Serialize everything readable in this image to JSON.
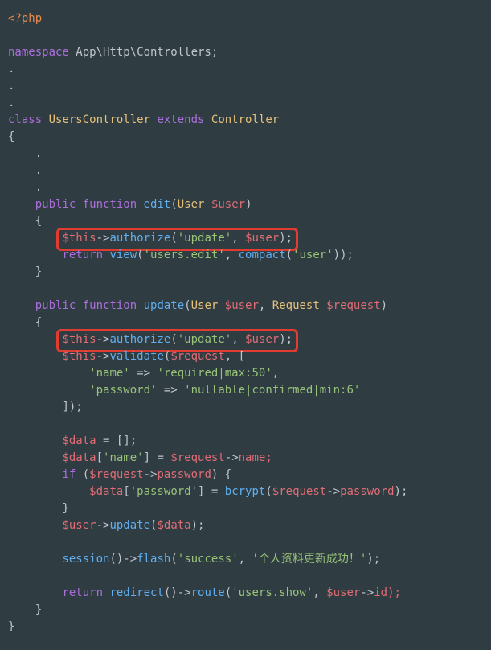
{
  "code": {
    "open_tag": "<?php",
    "ns_kw": "namespace",
    "ns": " App\\Http\\Controllers;",
    "dot1": ".",
    "dot2": ".",
    "dot3": ".",
    "class_kw": "class",
    "class_name": " UsersController ",
    "extends_kw": "extends",
    "base_class": " Controller",
    "ob": "{",
    "cb": "}",
    "dot4": ".",
    "dot5": ".",
    "dot6": ".",
    "public_kw": "public",
    "function_kw": " function",
    "edit_fn": " edit",
    "edit_params_open": "(",
    "user_type": "User ",
    "user_var": "$user",
    "edit_params_close": ")",
    "this_var": "$this",
    "arrow": "->",
    "authorize_fn": "authorize",
    "auth_open": "(",
    "update_str": "'update'",
    "comma": ", ",
    "auth_close": ");",
    "return_kw": "return",
    "view_fn": " view",
    "view_open": "(",
    "users_edit_str": "'users.edit'",
    "compact_fn": "compact",
    "compact_open": "(",
    "user_str": "'user'",
    "compact_close": "));",
    "update_fn": " update",
    "update_params_open": "(",
    "req_type": "Request ",
    "req_var": "$request",
    "update_params_close": ")",
    "validate_fn": "validate",
    "validate_open": "(",
    "arr_open": "[",
    "name_key_str": "'name'",
    "fat_arrow": " => ",
    "name_rule_str": "'required|max:50'",
    "comma2": ",",
    "pwd_key_str": "'password'",
    "pwd_rule_str": "'nullable|confirmed|min:6'",
    "arr_close": "]);",
    "data_var": "$data",
    "eq": " = ",
    "empty_arr": "[];",
    "data_name_open": "[",
    "data_name_close": "] = ",
    "req_arrow": "->",
    "name_prop": "name;",
    "if_kw": "if",
    "if_open": " (",
    "pwd_prop": "password",
    "if_close": ") {",
    "bcrypt_fn": "bcrypt",
    "bcrypt_open": "(",
    "bcrypt_close": ");",
    "if_cb": "}",
    "update_method": "update",
    "update_call_open": "(",
    "update_call_close": ");",
    "session_fn": "session",
    "session_call": "()->",
    "flash_fn": "flash",
    "flash_open": "(",
    "success_str": "'success'",
    "flash_msg": "'个人资料更新成功！'",
    "flash_close": ");",
    "redirect_fn": " redirect",
    "redirect_call": "()->",
    "route_fn": "route",
    "route_open": "(",
    "users_show_str": "'users.show'",
    "id_prop": "id);"
  }
}
